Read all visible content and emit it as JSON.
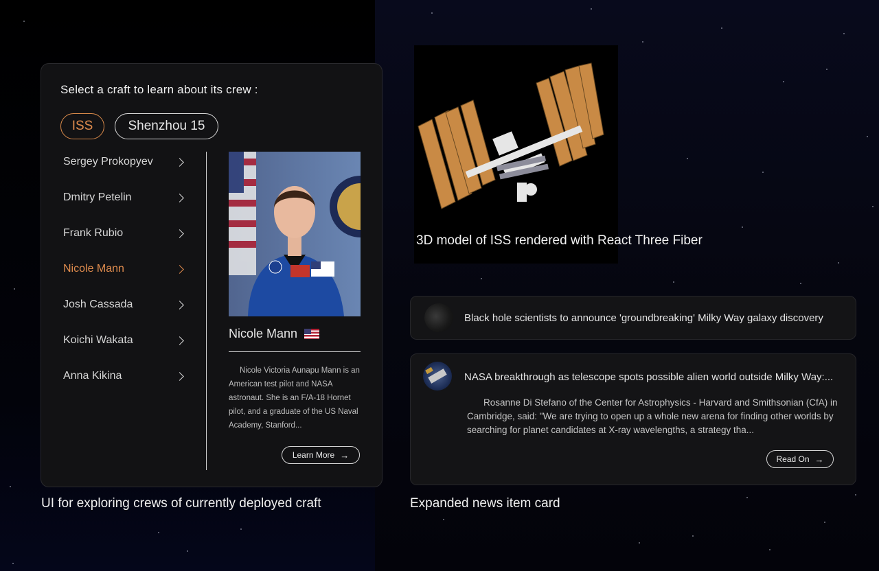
{
  "crew_explorer": {
    "prompt": "Select a craft to learn about its crew :",
    "crafts": [
      {
        "label": "ISS",
        "active": true
      },
      {
        "label": "Shenzhou 15",
        "active": false
      }
    ],
    "crew": [
      {
        "name": "Sergey Prokopyev",
        "active": false
      },
      {
        "name": "Dmitry Petelin",
        "active": false
      },
      {
        "name": "Frank Rubio",
        "active": false
      },
      {
        "name": "Nicole Mann",
        "active": true
      },
      {
        "name": "Josh Cassada",
        "active": false
      },
      {
        "name": "Koichi Wakata",
        "active": false
      },
      {
        "name": "Anna Kikina",
        "active": false
      }
    ],
    "selected": {
      "name": "Nicole Mann",
      "flag_icon": "us-flag-icon",
      "bio": "Nicole Victoria Aunapu Mann is an American test pilot and NASA astronaut. She is an F/A-18 Hornet pilot, and a graduate of the US Naval Academy, Stanford...",
      "learn_more_label": "Learn More",
      "learn_more_icon": "arrow-right-icon"
    },
    "caption": "UI for exploring crews of currently deployed craft"
  },
  "iss_model": {
    "caption": "3D model of ISS rendered with React Three Fiber"
  },
  "news": {
    "items": [
      {
        "title": "Black hole scientists to announce 'groundbreaking' Milky Way galaxy discovery",
        "expanded": false
      },
      {
        "title": "NASA breakthrough as telescope spots possible alien world outside Milky Way:...",
        "expanded": true,
        "body": "Rosanne Di Stefano of the Center for Astrophysics - Harvard and Smithsonian (CfA) in Cambridge, said: \"We are trying to open up a whole new arena for finding other worlds by searching for planet candidates at X-ray wavelengths, a strategy tha...",
        "read_label": "Read On",
        "read_icon": "arrow-right-icon"
      }
    ],
    "caption": "Expanded news item card"
  },
  "colors": {
    "accent": "#e08c4e",
    "panel": "#121214",
    "text": "#e8e8e8"
  }
}
